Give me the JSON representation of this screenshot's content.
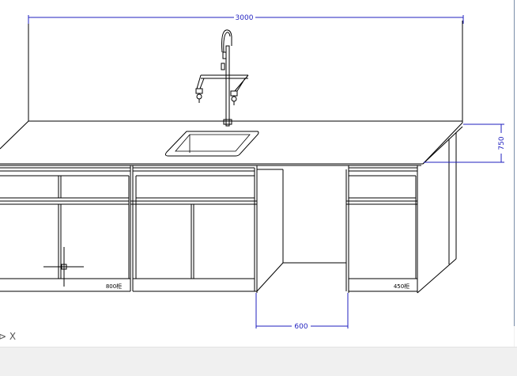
{
  "drawing": {
    "dimensions": {
      "width_total": "3000",
      "height_top": "750",
      "opening_width": "600"
    },
    "cabinet_labels": {
      "left_cabinet": "800柜",
      "right_cabinet": "450柜"
    },
    "command_prompt": "⊳ X",
    "colors": {
      "dimension": "#1f1fbf",
      "linework": "#000000",
      "background": "#ffffff"
    }
  }
}
